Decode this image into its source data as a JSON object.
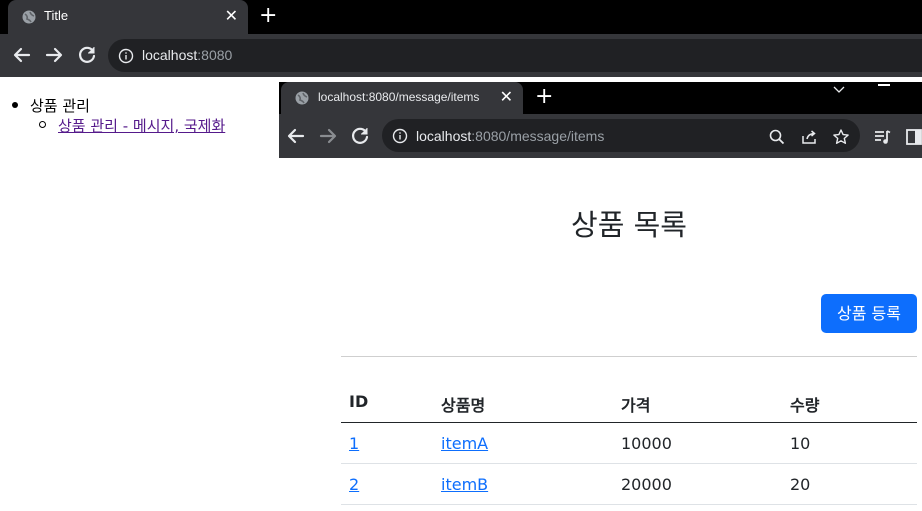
{
  "back_window": {
    "tab_title": "Title",
    "address_host": "localhost",
    "address_port": ":8080",
    "content": {
      "list_item": "상품 관리",
      "sub_link": "상품 관리 - 메시지, 국제화"
    }
  },
  "front_window": {
    "tab_title": "localhost:8080/message/items",
    "address_host": "localhost",
    "address_path": ":8080/message/items",
    "page_title": "상품 목록",
    "register_button": "상품 등록",
    "table": {
      "headers": [
        "ID",
        "상품명",
        "가격",
        "수량"
      ],
      "rows": [
        {
          "id": "1",
          "name": "itemA",
          "price": "10000",
          "quantity": "10"
        },
        {
          "id": "2",
          "name": "itemB",
          "price": "20000",
          "quantity": "20"
        }
      ]
    }
  },
  "colors": {
    "accent": "#0d6efd",
    "tab_bg": "#35363a",
    "omnibox_bg": "#202124",
    "visited_link": "#551a8b"
  },
  "icons": [
    "globe-icon",
    "close-icon",
    "new-tab-icon",
    "back-icon",
    "forward-icon",
    "reload-icon",
    "info-icon",
    "search-icon",
    "share-icon",
    "star-icon",
    "reading-list-icon",
    "side-panel-icon",
    "tab-search-icon",
    "minimize-icon"
  ]
}
